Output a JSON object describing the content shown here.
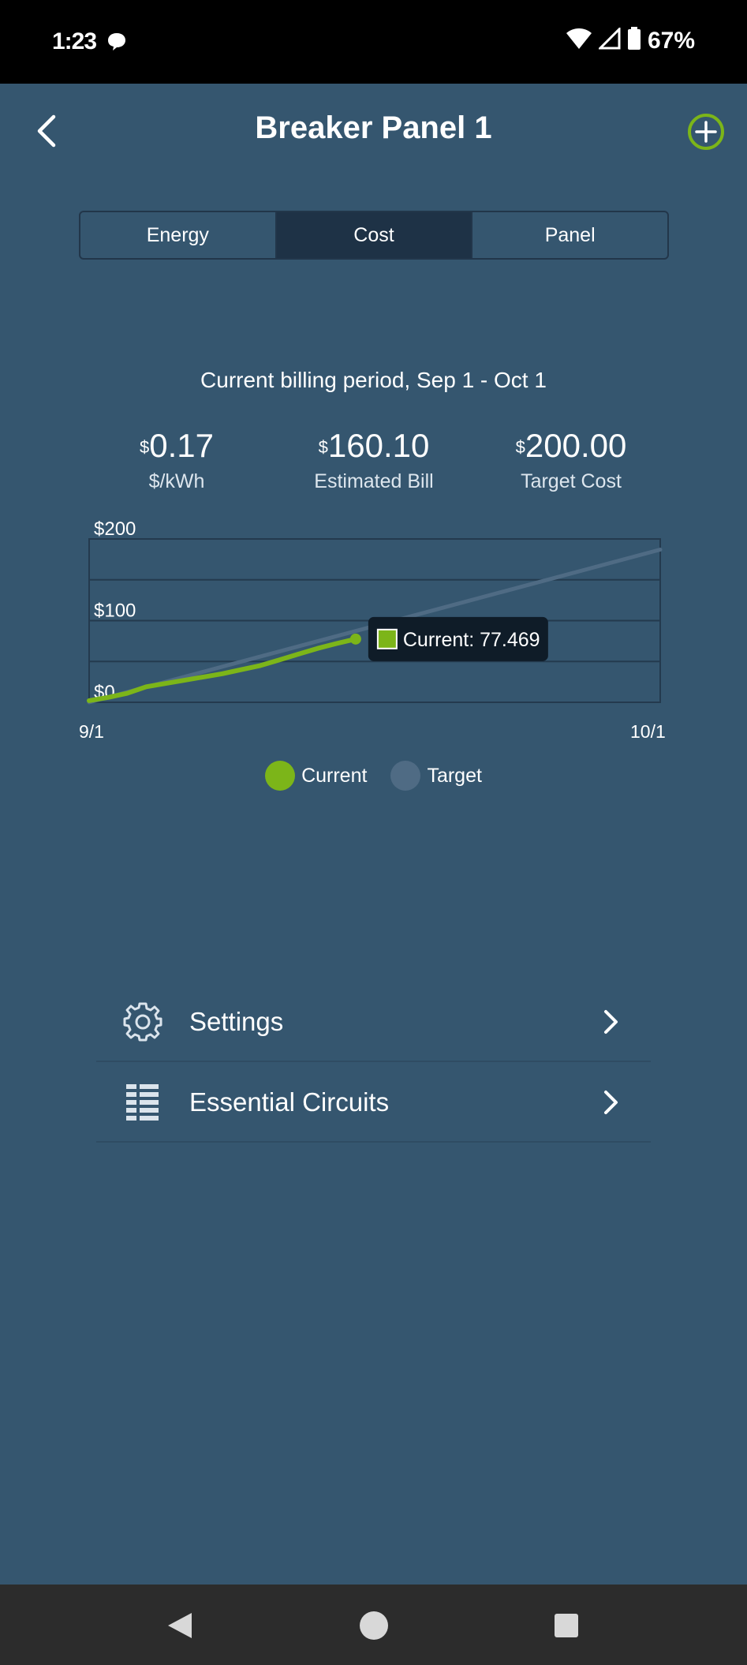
{
  "status_bar": {
    "time": "1:23",
    "battery": "67%"
  },
  "header": {
    "title": "Breaker Panel 1"
  },
  "tabs": [
    {
      "label": "Energy",
      "active": false
    },
    {
      "label": "Cost",
      "active": true
    },
    {
      "label": "Panel",
      "active": false
    }
  ],
  "billing": {
    "period": "Current billing period, Sep 1 - Oct 1"
  },
  "stats": [
    {
      "currency": "$",
      "value": "0.17",
      "label": "$/kWh"
    },
    {
      "currency": "$",
      "value": "160.10",
      "label": "Estimated Bill"
    },
    {
      "currency": "$",
      "value": "200.00",
      "label": "Target Cost"
    }
  ],
  "chart_data": {
    "type": "line",
    "x_start_label": "9/1",
    "x_end_label": "10/1",
    "y_ticks": [
      "$0",
      "$100",
      "$200"
    ],
    "ylim": [
      0,
      200
    ],
    "xlim": [
      0,
      30
    ],
    "series": [
      {
        "name": "Current",
        "color": "#7cb519",
        "x": [
          0,
          1,
          2,
          3,
          4,
          5,
          6,
          7,
          8,
          9,
          10,
          11,
          12,
          13,
          14
        ],
        "y": [
          2,
          6,
          11,
          19,
          23,
          27,
          31,
          35,
          40,
          45,
          52,
          59,
          66,
          72,
          77.469
        ]
      },
      {
        "name": "Target",
        "color": "#4f6b84",
        "x": [
          0,
          30
        ],
        "y": [
          0,
          187
        ]
      }
    ],
    "tooltip": {
      "text": "Current: 77.469",
      "series": "Current"
    },
    "grid": true,
    "legend_position": "bottom"
  },
  "menu": [
    {
      "label": "Settings",
      "icon": "gear-icon"
    },
    {
      "label": "Essential Circuits",
      "icon": "list-grid-icon"
    }
  ]
}
